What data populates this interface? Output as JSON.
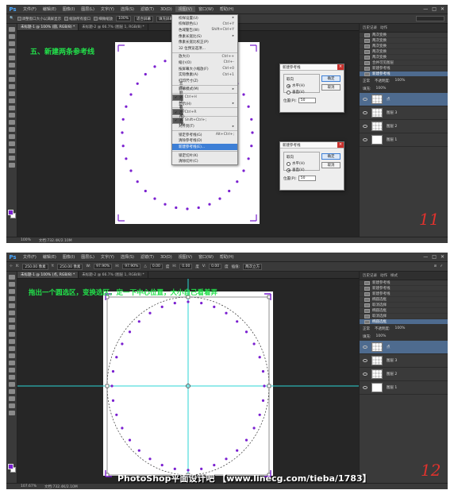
{
  "app": {
    "logo": "Ps",
    "menus": [
      "文件(F)",
      "编辑(E)",
      "图像(I)",
      "图层(L)",
      "文字(Y)",
      "选择(S)",
      "滤镜(T)",
      "3D(D)",
      "视图(V)",
      "窗口(W)",
      "帮助(H)"
    ],
    "window_controls": [
      "—",
      "□",
      "✕"
    ]
  },
  "shot1": {
    "caption": "五、新建两条参考线",
    "options_bar": [
      "调整窗口大小以满屏显示",
      "缩放所有窗口",
      "细微缩放",
      "100%",
      "适合屏幕",
      "填充屏幕",
      "打印尺寸"
    ],
    "tabs": [
      "未标题-1 @ 100% (圆, RGB/8) *",
      "未标题-2 @ 66.7% (图层 1, RGB/8) *"
    ],
    "zoom": "100%",
    "doc_info": "文档:732.4K/2.10M",
    "view_menu": [
      {
        "label": "校样设置(U)",
        "key": "▸"
      },
      {
        "label": "校样颜色(L)",
        "key": "Ctrl+Y"
      },
      {
        "label": "色域警告(W)",
        "key": "Shift+Ctrl+Y"
      },
      {
        "label": "像素长宽比(S)",
        "key": "▸"
      },
      {
        "label": "像素长宽比校正(P)",
        "key": ""
      },
      {
        "label": "32 位预览选项...",
        "key": ""
      },
      {
        "sep": true
      },
      {
        "label": "放大(I)",
        "key": "Ctrl++"
      },
      {
        "label": "缩小(O)",
        "key": "Ctrl+-"
      },
      {
        "label": "按屏幕大小缩放(F)",
        "key": "Ctrl+0"
      },
      {
        "label": "实际像素(A)",
        "key": "Ctrl+1"
      },
      {
        "label": "打印尺寸(Z)",
        "key": ""
      },
      {
        "sep": true
      },
      {
        "label": "屏幕模式(M)",
        "key": "▸"
      },
      {
        "sep": true
      },
      {
        "label": "显示额外内容(X)",
        "key": "Ctrl+H",
        "checked": true
      },
      {
        "label": "显示(H)",
        "key": "▸"
      },
      {
        "sep": true
      },
      {
        "label": "标尺(R)",
        "key": "Ctrl+R",
        "checked": true
      },
      {
        "sep": true
      },
      {
        "label": "对齐(N)",
        "key": "Shift+Ctrl+;",
        "checked": true
      },
      {
        "label": "对齐到(T)",
        "key": "▸"
      },
      {
        "sep": true
      },
      {
        "label": "锁定参考线(G)",
        "key": "Alt+Ctrl+;"
      },
      {
        "label": "清除参考线(D)",
        "key": ""
      },
      {
        "label": "新建参考线(E)...",
        "key": "",
        "selected": true
      },
      {
        "sep": true
      },
      {
        "label": "锁定切片(K)",
        "key": ""
      },
      {
        "label": "清除切片(C)",
        "key": ""
      }
    ],
    "dialogs": [
      {
        "title": "新建参考线",
        "group": "取向",
        "h_label": "水平(H)",
        "v_label": "垂直(V)",
        "orient": "horizontal",
        "ok": "确定",
        "cancel": "取消",
        "pos_label": "位置(P):",
        "pos_value": "50"
      },
      {
        "title": "新建参考线",
        "group": "取向",
        "h_label": "水平(H)",
        "v_label": "垂直(V)",
        "orient": "vertical",
        "ok": "确定",
        "cancel": "取消",
        "pos_label": "位置(P):",
        "pos_value": "50"
      }
    ],
    "history_tabs": [
      "历史记录",
      "动作"
    ],
    "history": [
      "两次变换",
      "两次变换",
      "两次变换",
      "两次变换",
      "两次变换",
      "合并可见图层",
      "新建参考线",
      "新建参考线"
    ],
    "history_selected": 7,
    "layer_mode": "正常",
    "opacity_label": "不透明度:",
    "opacity": "100%",
    "fill_label": "填充:",
    "fill": "100%",
    "layers": [
      "点",
      "图层 3",
      "图层 2",
      "图层 1"
    ],
    "layer_selected": 0,
    "hand_number": "11"
  },
  "shot2": {
    "caption": "拖出一个圆选区，变换选区，定一下中心位置，大小自己看着弄",
    "options_bar": [
      "X:",
      "250.00 像素",
      "Y:",
      "250.00 像素",
      "W:",
      "97.90%",
      "H:",
      "97.90%",
      "△",
      "0.00",
      "度",
      "H:",
      "0.00",
      "度",
      "V:",
      "0.00",
      "度",
      "插值:",
      "两次立方"
    ],
    "tabs": [
      "未标题-1 @ 100% (点, RGB/8) *",
      "未标题-2 @ 66.7% (图层 1, RGB/8) *"
    ],
    "zoom": "107.67%",
    "doc_info": "文档:732.4K/2.10M",
    "history_tabs": [
      "历史记录",
      "动作",
      "样式"
    ],
    "history": [
      "新建参考线",
      "新建参考线",
      "新建参考线",
      "椭圆选框",
      "取消选择",
      "椭圆选框",
      "取消选择",
      "椭圆选框"
    ],
    "history_selected": 7,
    "layer_mode": "正常",
    "opacity_label": "不透明度:",
    "opacity": "100%",
    "fill_label": "填充:",
    "fill": "100%",
    "layers": [
      "点",
      "图层 3",
      "图层 2",
      "图层 1"
    ],
    "layer_selected": 0,
    "watermark": "PhotoShop平面设计吧 【www.linecg.com/tieba/1783】",
    "hand_number": "12"
  },
  "colors": {
    "accent": "#7a1fd0",
    "guide": "#2bd4d4",
    "caption": "#22e04a",
    "selection_blue": "#3d7fd6",
    "hand_red": "#e0322d"
  }
}
